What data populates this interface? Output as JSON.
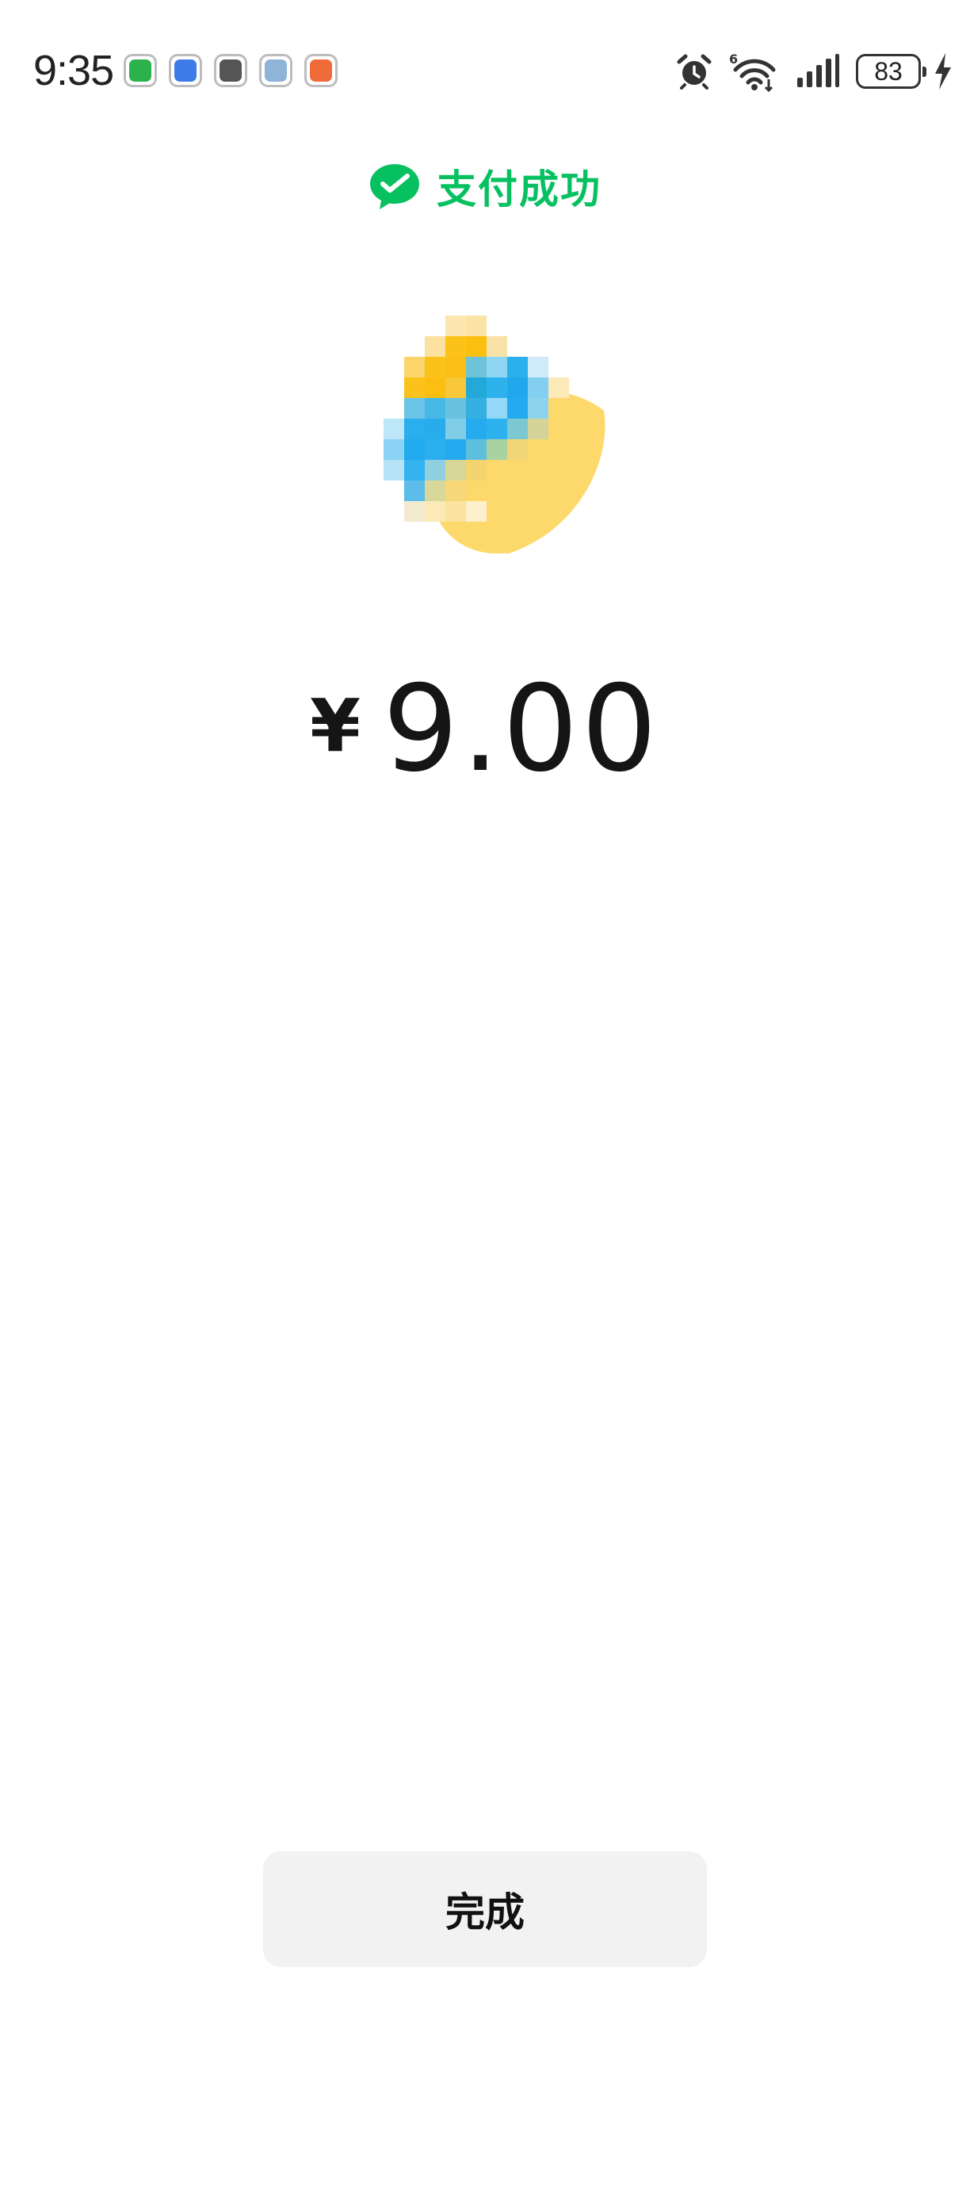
{
  "status_bar": {
    "time": "9:35",
    "notification_icons": [
      {
        "name": "wechat-notif-icon",
        "color": "#2bb24c"
      },
      {
        "name": "clock-notif-icon",
        "color": "#3d7be8"
      },
      {
        "name": "app-notif-icon",
        "color": "#555555"
      },
      {
        "name": "browser-notif-icon",
        "color": "#8fb4d8"
      },
      {
        "name": "app2-notif-icon",
        "color": "#ef6b3a"
      }
    ],
    "battery_level": "83"
  },
  "header": {
    "title": "支付成功",
    "icon": "wechat-pay-icon",
    "accent_color": "#07c160"
  },
  "payment": {
    "currency_symbol": "¥",
    "amount": "9.00"
  },
  "actions": {
    "done_label": "完成"
  }
}
